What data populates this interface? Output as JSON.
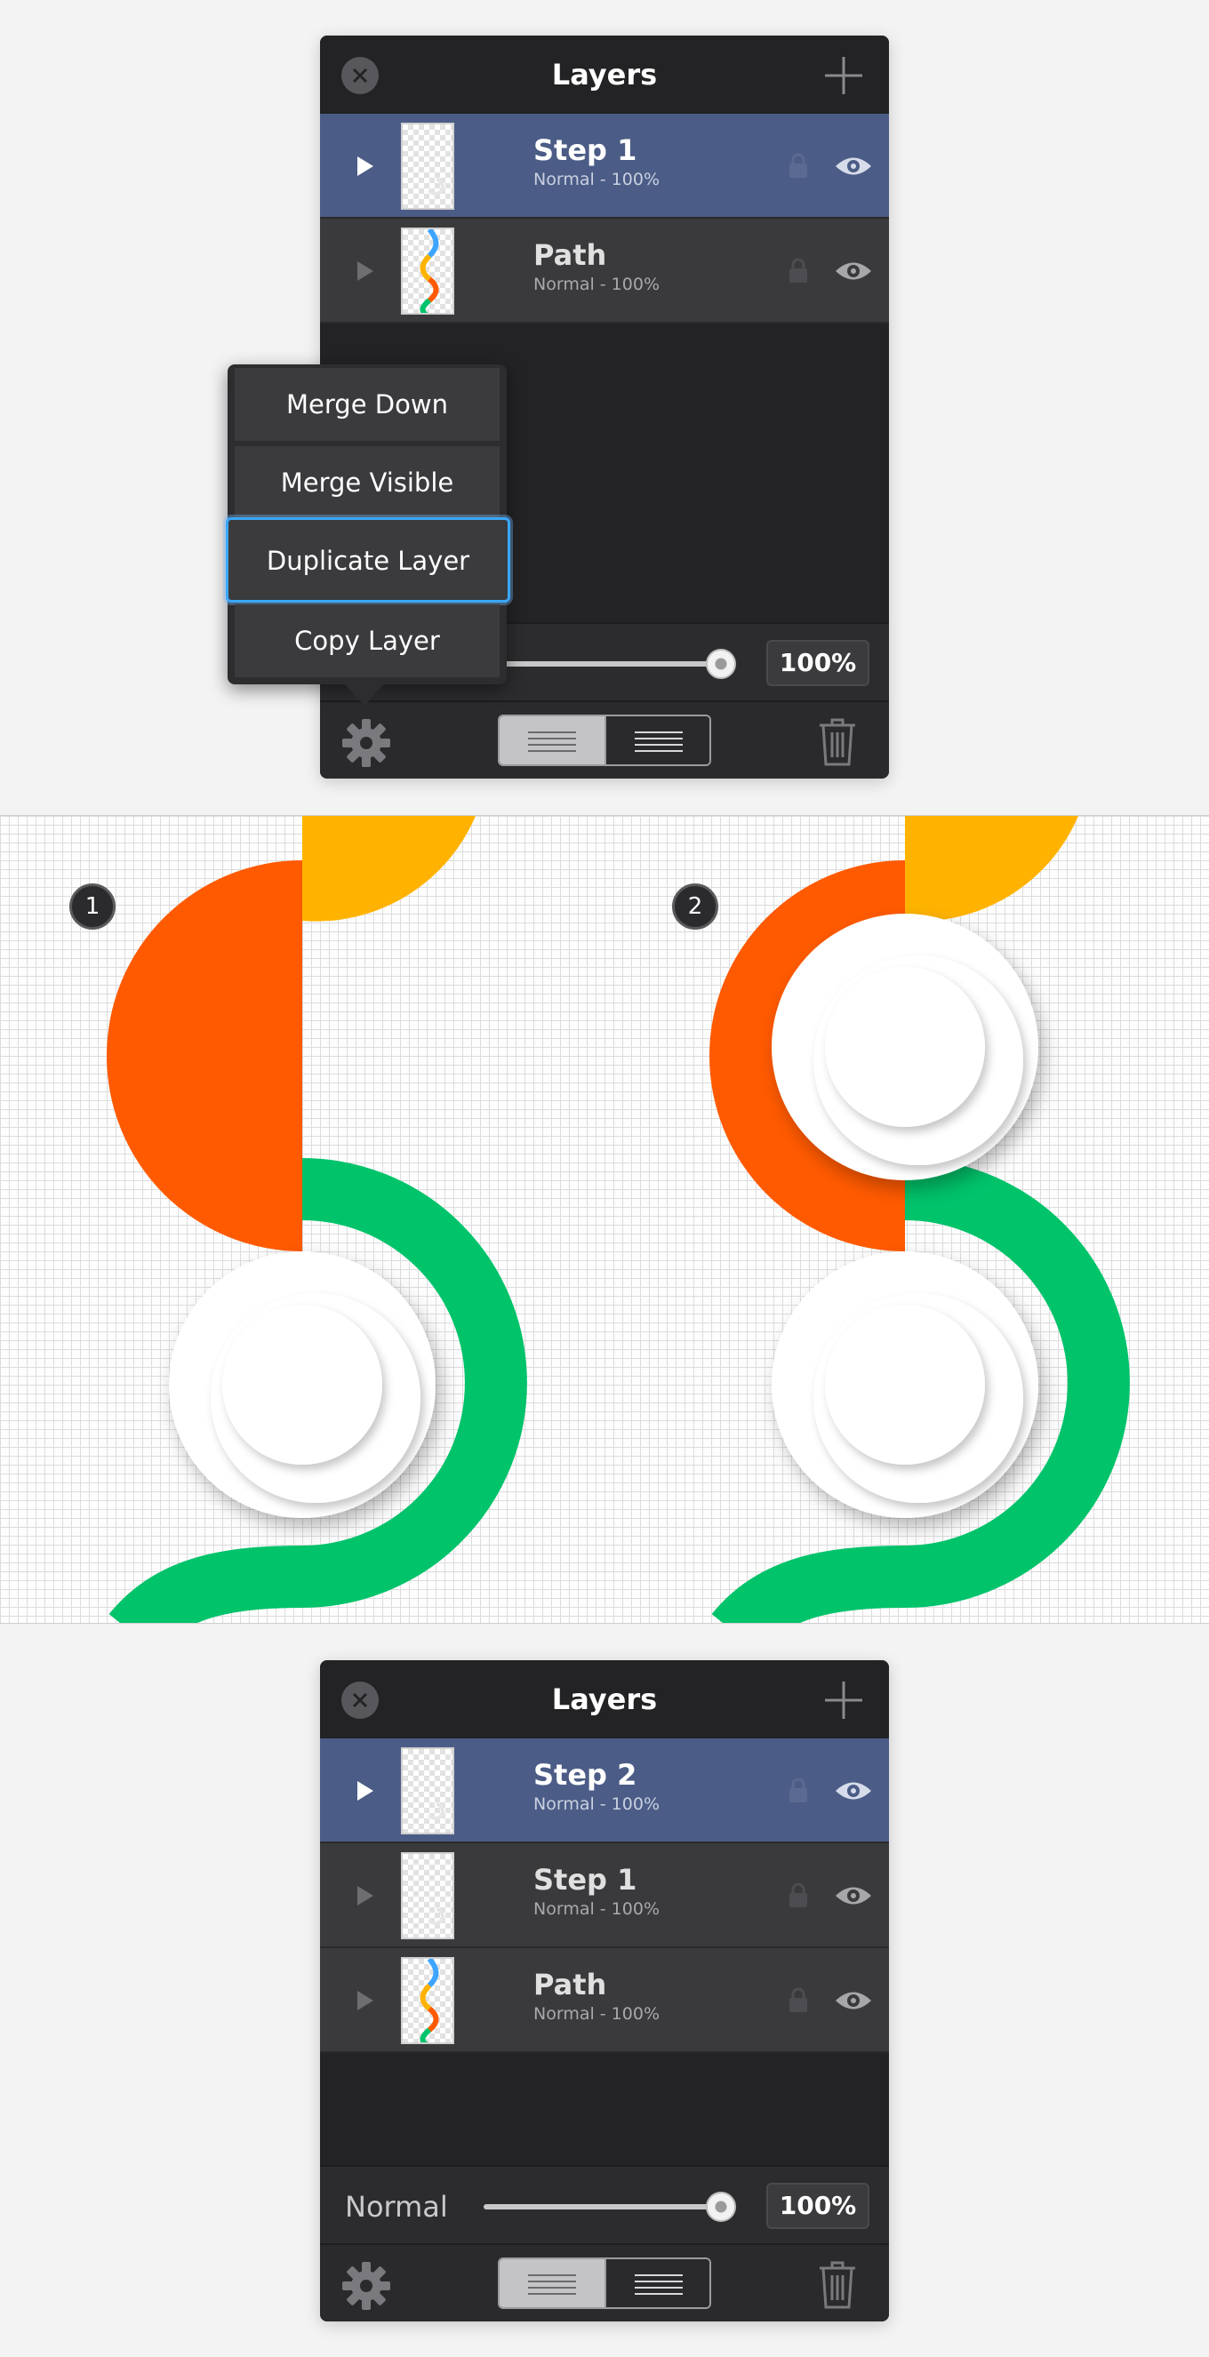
{
  "panel_top": {
    "title": "Layers",
    "layers": [
      {
        "name": "Step 1",
        "sub": "Normal - 100%"
      },
      {
        "name": "Path",
        "sub": "Normal - 100%"
      }
    ],
    "opacity": "100%"
  },
  "menu": {
    "items": [
      "Merge Down",
      "Merge Visible",
      "Duplicate Layer",
      "Copy Layer"
    ],
    "highlighted": "Duplicate Layer"
  },
  "canvas": {
    "steps": [
      "1",
      "2"
    ],
    "colors": {
      "orange": "#ff5a00",
      "yellow": "#ffb300",
      "green": "#00c36a"
    }
  },
  "panel_bottom": {
    "title": "Layers",
    "layers": [
      {
        "name": "Step 2",
        "sub": "Normal - 100%"
      },
      {
        "name": "Step 1",
        "sub": "Normal - 100%"
      },
      {
        "name": "Path",
        "sub": "Normal - 100%"
      }
    ],
    "blend_mode": "Normal",
    "opacity": "100%"
  }
}
